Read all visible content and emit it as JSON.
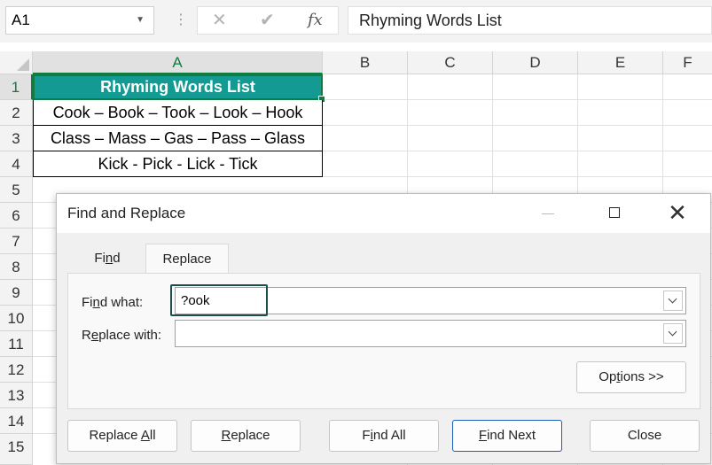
{
  "formula_bar": {
    "name_box": "A1",
    "separator": "⋮",
    "cancel_glyph": "✕",
    "enter_glyph": "✔",
    "fx_label": "fx",
    "formula_text": "Rhyming Words List"
  },
  "sheet": {
    "columns": [
      "A",
      "B",
      "C",
      "D",
      "E",
      "F"
    ],
    "rows": [
      "1",
      "2",
      "3",
      "4",
      "5",
      "6",
      "7",
      "8",
      "9",
      "10",
      "11",
      "12",
      "13",
      "14",
      "15"
    ],
    "cells": {
      "A1": "Rhyming Words List",
      "A2": "Cook – Book – Took – Look – Hook",
      "A3": "Class – Mass – Gas – Pass – Glass",
      "A4": "Kick - Pick - Lick - Tick"
    },
    "header_fill": "#139a93",
    "selection_color": "#107c41"
  },
  "dialog": {
    "title": "Find and Replace",
    "close_glyph": "✕",
    "tabs": {
      "find": {
        "pre": "Fi",
        "key": "n",
        "post": "d"
      },
      "replace": {
        "label": "Replace"
      }
    },
    "find_what": {
      "label": {
        "pre": "Fi",
        "key": "n",
        "post": "d what:"
      },
      "value": "?ook"
    },
    "replace_with": {
      "label": {
        "pre": "R",
        "key": "e",
        "post": "place with:"
      },
      "value": ""
    },
    "options_button": {
      "pre": "Op",
      "key": "t",
      "post": "ions >>"
    },
    "buttons": {
      "replace_all": {
        "pre": "Replace ",
        "key": "A",
        "post": "ll"
      },
      "replace": {
        "pre": "",
        "key": "R",
        "post": "eplace"
      },
      "find_all": {
        "pre": "F",
        "key": "i",
        "post": "nd All"
      },
      "find_next": {
        "pre": "",
        "key": "F",
        "post": "ind Next"
      },
      "close": {
        "label": "Close"
      }
    }
  }
}
